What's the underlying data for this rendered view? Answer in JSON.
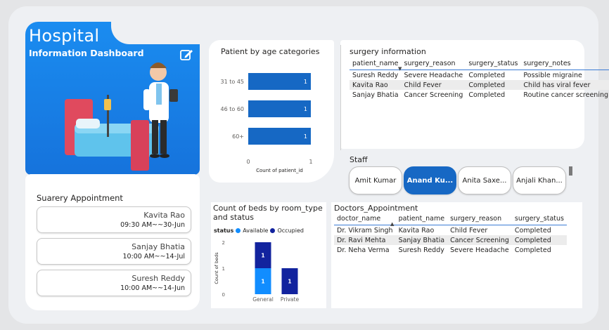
{
  "hero": {
    "title": "Hospital",
    "subtitle": "Information Dashboard",
    "edit_icon": "edit-icon"
  },
  "appointments": {
    "title": "Suarery Appointment",
    "items": [
      {
        "name": "Kavita Rao",
        "time": "09:30 AM~~30-Jun"
      },
      {
        "name": "Sanjay Bhatia",
        "time": "10:00 AM~~14-Jul"
      },
      {
        "name": "Suresh Reddy",
        "time": "10:00 AM~~14-Jun"
      }
    ]
  },
  "age_chart": {
    "title": "Patient by age categories",
    "xlabel": "Count of patient_id",
    "tick_min": "0",
    "tick_max": "1",
    "chart_data": {
      "type": "bar",
      "categories": [
        "31 to 45",
        "46 to 60",
        "60+"
      ],
      "values": [
        1,
        1,
        1
      ],
      "xlim": [
        0,
        1
      ],
      "xlabel": "Count of patient_id",
      "color": "#1668c4"
    }
  },
  "surgery_info": {
    "title": "surgery information",
    "columns": [
      "patient_name",
      "surgery_reason",
      "surgery_status",
      "surgery_notes"
    ],
    "rows": [
      [
        "Suresh Reddy",
        "Severe Headache",
        "Completed",
        "Possible migraine"
      ],
      [
        "Kavita Rao",
        "Child Fever",
        "Completed",
        "Child has viral fever"
      ],
      [
        "Sanjay Bhatia",
        "Cancer Screening",
        "Completed",
        "Routine cancer screening"
      ]
    ]
  },
  "staff": {
    "title": "Staff",
    "items": [
      "Amit Kumar",
      "Anand Ku...",
      "Anita Saxe...",
      "Anjali Khan..."
    ],
    "selected": "Anand Ku..."
  },
  "beds_chart": {
    "title_line1": "Count of beds by room_type",
    "title_line2": "and status",
    "legend_title": "status",
    "legend": [
      "Available",
      "Occupied"
    ],
    "ylabel": "Count of beds",
    "yticks": [
      "2",
      "1",
      "0"
    ],
    "chart_data": {
      "type": "bar",
      "stacked": true,
      "categories": [
        "General",
        "Private"
      ],
      "series": [
        {
          "name": "Available",
          "values": [
            1,
            0
          ],
          "color": "#118dff"
        },
        {
          "name": "Occupied",
          "values": [
            1,
            1
          ],
          "color": "#12239e"
        }
      ],
      "ylim": [
        0,
        2
      ],
      "ylabel": "Count of beds"
    }
  },
  "doctors_appt": {
    "title": "Doctors_Appointment",
    "columns": [
      "doctor_name",
      "patient_name",
      "surgery_reason",
      "surgery_status"
    ],
    "rows": [
      [
        "Dr. Vikram Singh",
        "Kavita Rao",
        "Child Fever",
        "Completed"
      ],
      [
        "Dr. Ravi Mehta",
        "Sanjay Bhatia",
        "Cancer Screening",
        "Completed"
      ],
      [
        "Dr. Neha Verma",
        "Suresh Reddy",
        "Severe Headache",
        "Completed"
      ]
    ]
  }
}
